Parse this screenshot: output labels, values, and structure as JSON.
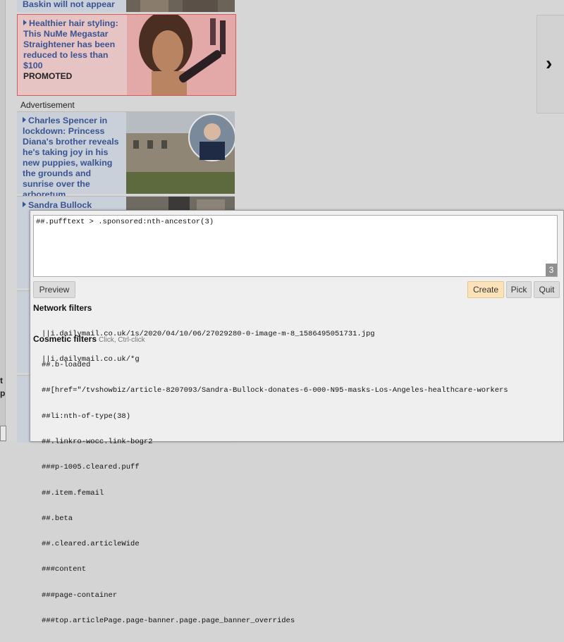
{
  "background": {
    "top_snippet": "Baskin will not appear",
    "promo": {
      "headline": "Healthier hair styling: This NuMe Megastar Straightener has been reduced to less than $100",
      "label": "PROMOTED"
    },
    "ad_label": "Advertisement",
    "article1": "Charles Spencer in lockdown: Princess Diana's brother reveals he's taking joy in his new puppies, walking the grounds and sunrise over the arboretum",
    "article2": "Sandra Bullock",
    "left_bits": [
      "t",
      "p"
    ]
  },
  "picker": {
    "filter_text": "##.pufftext > .sponsored:nth-ancestor(3)",
    "count": "3",
    "buttons": {
      "preview": "Preview",
      "create": "Create",
      "pick": "Pick",
      "quit": "Quit"
    },
    "network_title": "Network filters",
    "network_filters": [
      "||i.dailymail.co.uk/1s/2020/04/10/06/27029280-0-image-m-8_1586495051731.jpg",
      "||i.dailymail.co.uk/*g"
    ],
    "cosmetic_title": "Cosmetic filters",
    "cosmetic_hint": "Click, Ctrl-click",
    "cosmetic_filters": [
      "##.b-loaded",
      "##[href=\"/tvshowbiz/article-8207093/Sandra-Bullock-donates-6-000-N95-masks-Los-Angeles-healthcare-workers",
      "##li:nth-of-type(38)",
      "##.linkro-wocc.link-bogr2",
      "###p-1005.cleared.puff",
      "##.item.femail",
      "##.beta",
      "##.cleared.articleWide",
      "###content",
      "###page-container",
      "###top.articlePage.page-banner.page.page_banner_overrides"
    ]
  },
  "colors": {
    "link": "#3a5391",
    "create_button": "#fbe2b8",
    "promo_border": "#d65b5b"
  },
  "icons": {
    "next": "chevron-right-icon",
    "bullet": "triangle-right-icon"
  }
}
